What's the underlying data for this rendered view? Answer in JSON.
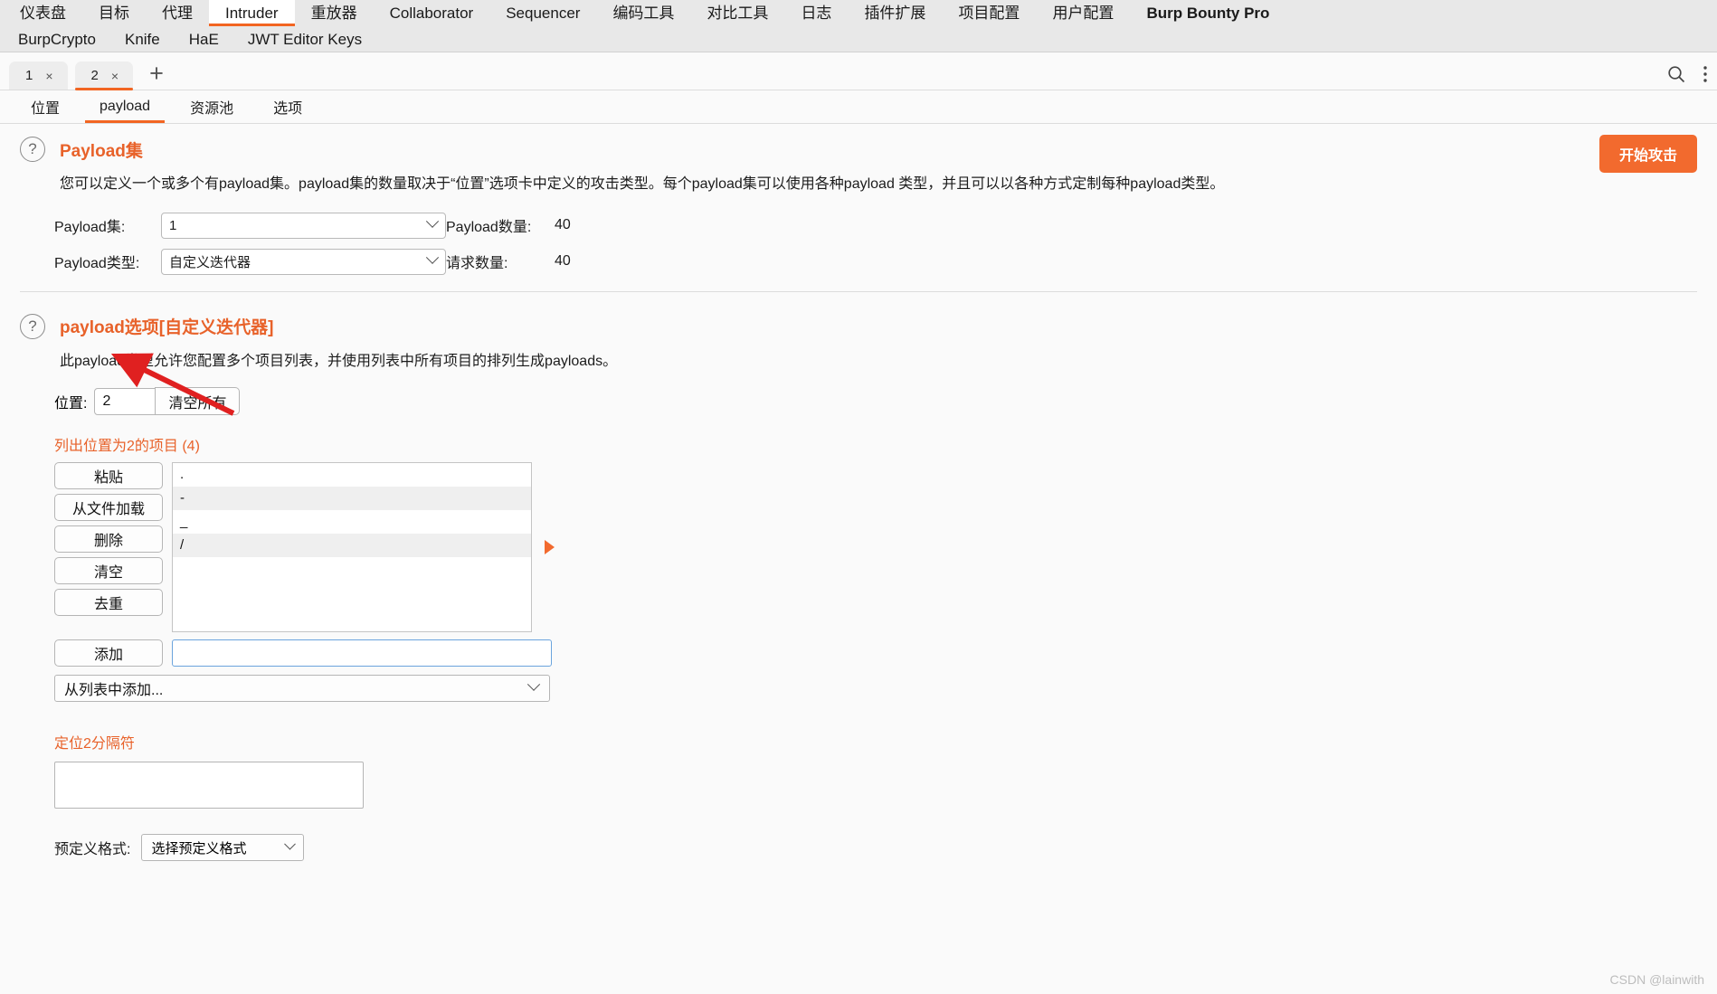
{
  "topnav": {
    "row1": [
      {
        "label": "仪表盘",
        "active": false
      },
      {
        "label": "目标",
        "active": false
      },
      {
        "label": "代理",
        "active": false
      },
      {
        "label": "Intruder",
        "active": true
      },
      {
        "label": "重放器",
        "active": false
      },
      {
        "label": "Collaborator",
        "active": false
      },
      {
        "label": "Sequencer",
        "active": false
      },
      {
        "label": "编码工具",
        "active": false
      },
      {
        "label": "对比工具",
        "active": false
      },
      {
        "label": "日志",
        "active": false
      },
      {
        "label": "插件扩展",
        "active": false
      },
      {
        "label": "项目配置",
        "active": false
      },
      {
        "label": "用户配置",
        "active": false
      },
      {
        "label": "Burp Bounty Pro",
        "active": false
      }
    ],
    "row2": [
      {
        "label": "BurpCrypto"
      },
      {
        "label": "Knife"
      },
      {
        "label": "HaE"
      },
      {
        "label": "JWT Editor Keys"
      }
    ]
  },
  "attack_tabs": {
    "tabs": [
      {
        "label": "1",
        "close": "×",
        "active": false
      },
      {
        "label": "2",
        "close": "×",
        "active": true
      }
    ],
    "new_tab": "+",
    "search_icon": "search-icon",
    "menu_icon": "more-vertical-icon"
  },
  "subtabs": [
    {
      "label": "位置",
      "active": false
    },
    {
      "label": "payload",
      "active": true
    },
    {
      "label": "资源池",
      "active": false
    },
    {
      "label": "选项",
      "active": false
    }
  ],
  "payload_sets": {
    "help_icon": "?",
    "title": "Payload集",
    "description": "您可以定义一个或多个有payload集。payload集的数量取决于“位置”选项卡中定义的攻击类型。每个payload集可以使用各种payload 类型，并且可以以各种方式定制每种payload类型。",
    "start_attack_label": "开始攻击",
    "set_label": "Payload集:",
    "set_value": "1",
    "type_label": "Payload类型:",
    "type_value": "自定义迭代器",
    "count_label": "Payload数量:",
    "count_value": "40",
    "request_label": "请求数量:",
    "request_value": "40"
  },
  "payload_options": {
    "help_icon": "?",
    "title": "payload选项[自定义迭代器]",
    "description": "此payload类型允许您配置多个项目列表，并使用列表中所有项目的排列生成payloads。",
    "position_label": "位置:",
    "position_value": "2",
    "clear_all_label": "清空所有",
    "list_caption": "列出位置为2的项目 (4)",
    "buttons": [
      {
        "label": "粘贴"
      },
      {
        "label": "从文件加载"
      },
      {
        "label": "删除"
      },
      {
        "label": "清空"
      },
      {
        "label": "去重"
      }
    ],
    "items": [
      ".",
      "-",
      "_",
      "/"
    ],
    "add_label": "添加",
    "add_value": "",
    "add_placeholder": "",
    "from_list_label": "从列表中添加...",
    "separator_label": "定位2分隔符",
    "separator_value": "",
    "predef_label": "预定义格式:",
    "predef_value": "选择预定义格式"
  },
  "watermark": "CSDN @lainwith"
}
